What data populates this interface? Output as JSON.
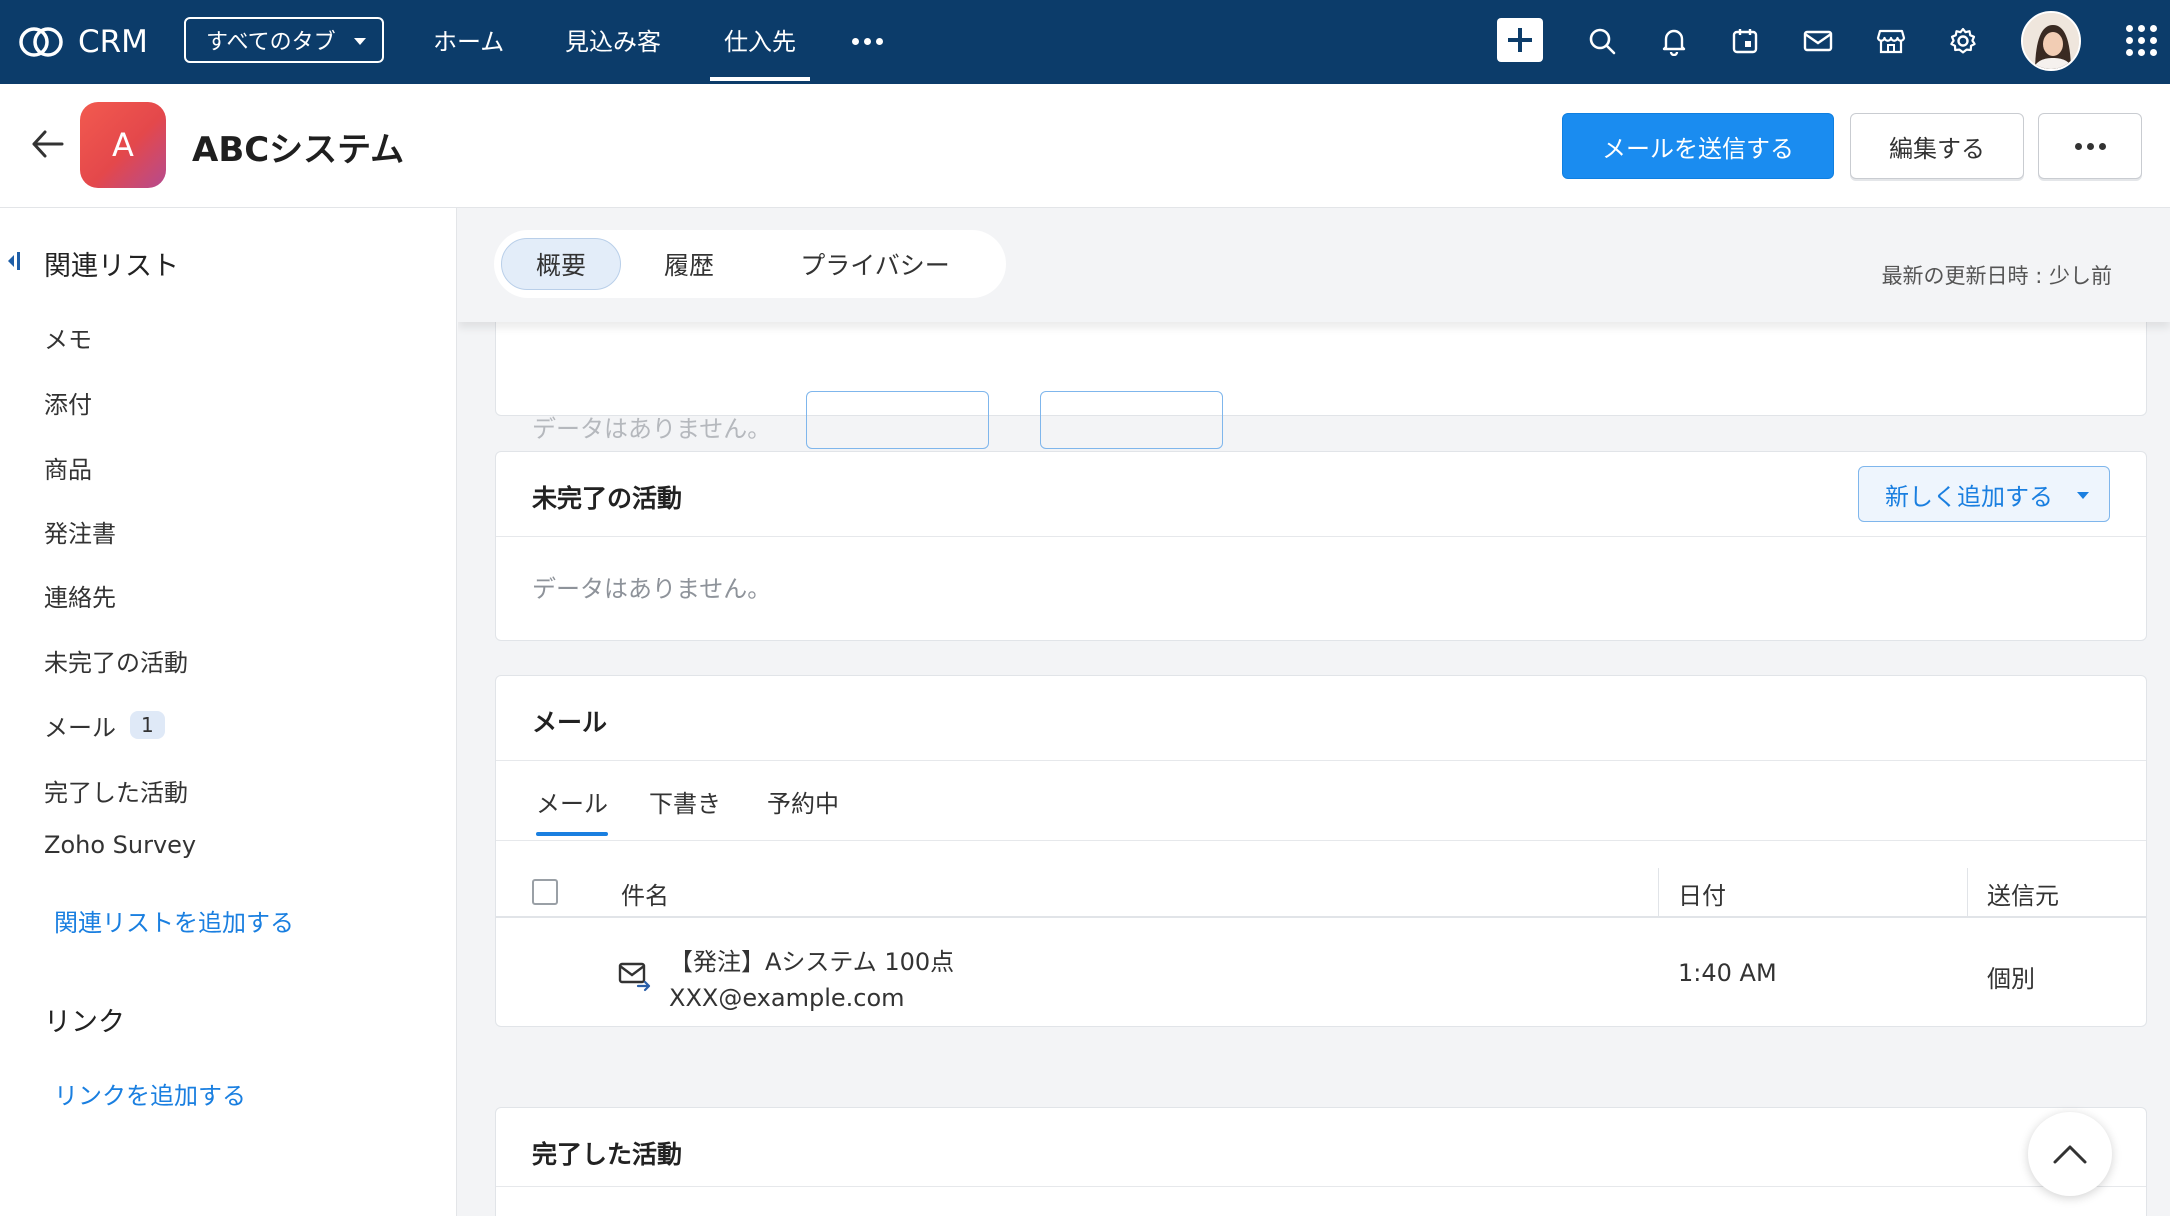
{
  "topnav": {
    "logo_text": "CRM",
    "tab_select": "すべてのタブ",
    "links": [
      "ホーム",
      "見込み客",
      "仕入先"
    ],
    "active_link": "仕入先",
    "icons": [
      "plus-icon",
      "search-icon",
      "bell-icon",
      "calendar-icon",
      "mail-icon",
      "store-icon",
      "gear-icon",
      "avatar",
      "apps-grid-icon"
    ]
  },
  "record": {
    "avatar_letter": "A",
    "title": "ABCシステム",
    "send_mail": "メールを送信する",
    "edit": "編集する"
  },
  "sidebar": {
    "heading": "関連リスト",
    "items": [
      "メモ",
      "添付",
      "商品",
      "発注書",
      "連絡先",
      "未完了の活動",
      "メール",
      "完了した活動",
      "Zoho Survey"
    ],
    "mail_count": "1",
    "add_related": "関連リストを追加する",
    "links_heading": "リンク",
    "add_link": "リンクを追加する"
  },
  "tabs": {
    "items": [
      "概要",
      "履歴",
      "プライバシー"
    ],
    "active": "概要",
    "updated": "最新の更新日時 : 少し前"
  },
  "cards": {
    "top_partial": {
      "empty": "データはありません。"
    },
    "open_activities": {
      "title": "未完了の活動",
      "add_new": "新しく追加する",
      "empty": "データはありません。"
    },
    "mail": {
      "title": "メール",
      "subtabs": [
        "メール",
        "下書き",
        "予約中"
      ],
      "active_subtab": "メール",
      "columns": [
        "件名",
        "日付",
        "送信元"
      ],
      "rows": [
        {
          "subject": "【発注】Aシステム 100点",
          "address": "XXX@example.com",
          "date": "1:40 AM",
          "source": "個別"
        }
      ]
    },
    "closed_activities": {
      "title": "完了した活動"
    }
  },
  "colors": {
    "nav_bg": "#0c3c6a",
    "primary": "#1a8cf0",
    "link": "#1a7fe0"
  }
}
